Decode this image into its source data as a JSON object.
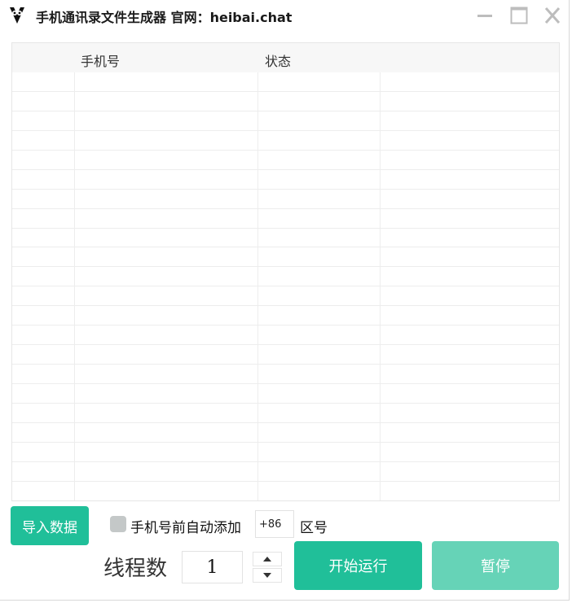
{
  "window": {
    "title": "手机通讯录文件生成器 官网：heibai.chat",
    "controls": {
      "minimize_icon": "minimize-icon",
      "maximize_icon": "maximize-icon",
      "close_icon": "close-icon"
    }
  },
  "table": {
    "columns": [
      "",
      "手机号",
      "状态",
      ""
    ],
    "rows": []
  },
  "controls": {
    "import_label": "导入数据",
    "auto_prefix_label": "手机号前自动添加",
    "auto_prefix_checked": false,
    "area_code_value": "+86",
    "area_code_suffix": "区号",
    "thread_label": "线程数",
    "thread_value": "1",
    "start_label": "开始运行",
    "pause_label": "暂停"
  },
  "colors": {
    "accent": "#20bf99",
    "accent_disabled": "#66d3b7",
    "checkbox": "#c4c8c8"
  }
}
